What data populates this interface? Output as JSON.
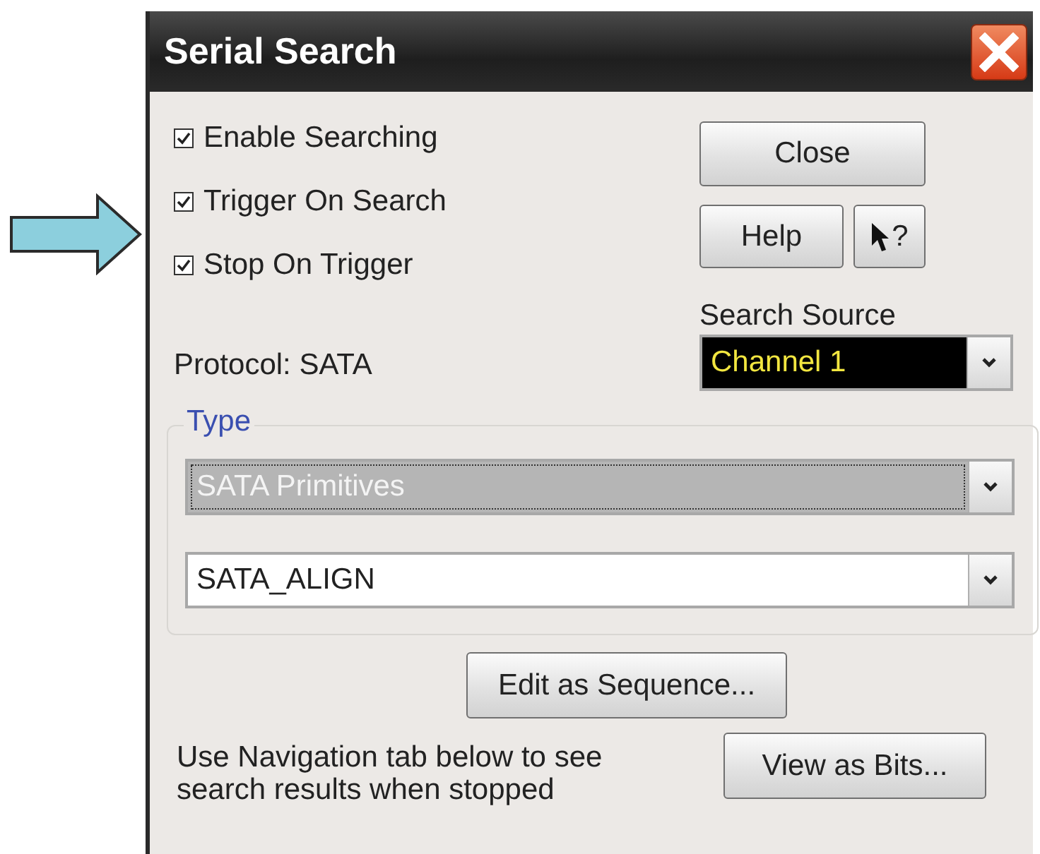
{
  "window": {
    "title": "Serial Search"
  },
  "checkboxes": [
    {
      "label": "Enable Searching",
      "checked": true
    },
    {
      "label": "Trigger On Search",
      "checked": true
    },
    {
      "label": "Stop On Trigger",
      "checked": true
    }
  ],
  "buttons": {
    "close": "Close",
    "help": "Help",
    "whats_this": "?"
  },
  "protocol": "Protocol: SATA",
  "search_source": {
    "label": "Search Source",
    "value": "Channel 1",
    "kind": "dark"
  },
  "type_group": {
    "title": "Type",
    "dropdowns": [
      {
        "value": "SATA Primitives",
        "kind": "highlighted"
      },
      {
        "value": "SATA_ALIGN",
        "kind": "normal"
      }
    ]
  },
  "edit_button": "Edit as Sequence...",
  "note": "Use Navigation tab below to see search results when stopped",
  "view_button": "View as Bits..."
}
